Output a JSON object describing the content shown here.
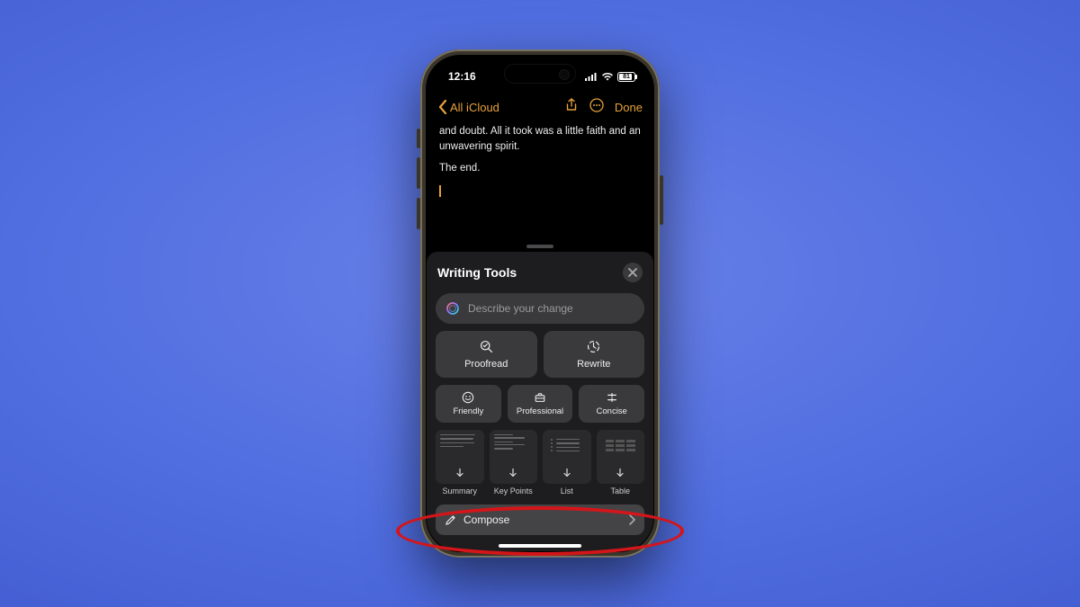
{
  "status": {
    "time": "12:16",
    "battery": "81"
  },
  "nav": {
    "back_label": "All iCloud",
    "done_label": "Done"
  },
  "note": {
    "line1": "and doubt. All it took was a little faith and an unwavering spirit.",
    "line2": "The end."
  },
  "sheet": {
    "title": "Writing Tools",
    "describe_placeholder": "Describe your change",
    "proofread": "Proofread",
    "rewrite": "Rewrite",
    "friendly": "Friendly",
    "professional": "Professional",
    "concise": "Concise",
    "formats": {
      "summary": "Summary",
      "key_points": "Key Points",
      "list": "List",
      "table": "Table"
    },
    "compose": "Compose"
  }
}
